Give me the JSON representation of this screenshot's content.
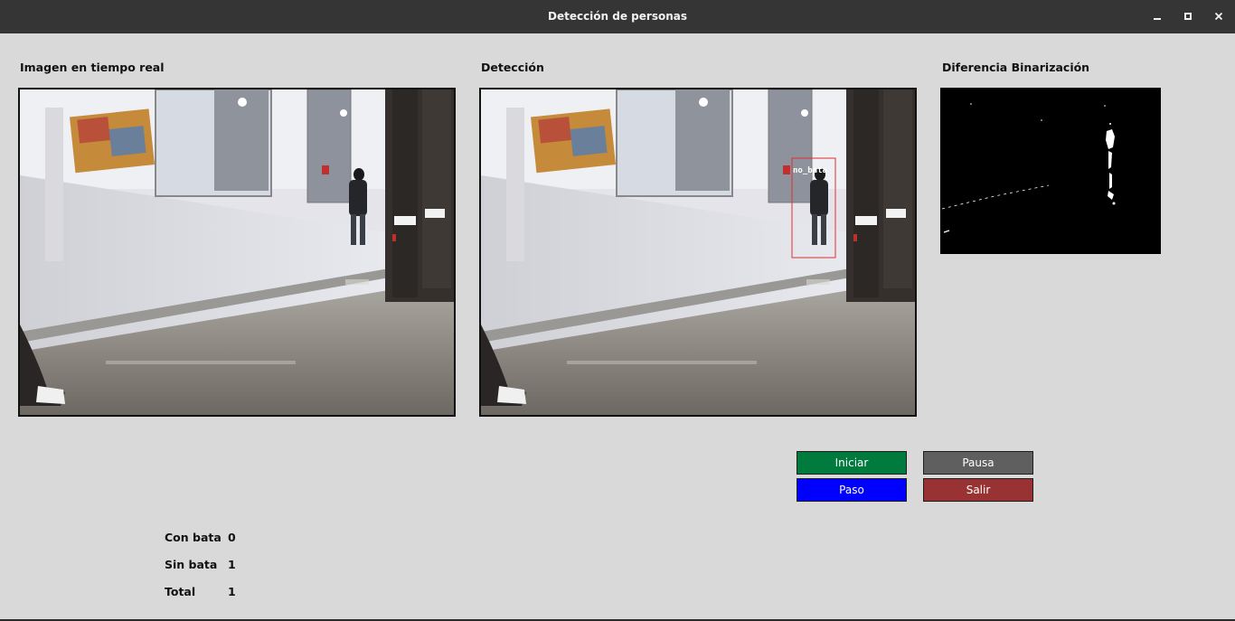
{
  "window": {
    "title": "Detección de personas"
  },
  "panels": {
    "live_label": "Imagen en tiempo real",
    "detection_label": "Detección",
    "binarization_label": "Diferencia Binarización"
  },
  "detection": {
    "box_label": "no_bata",
    "box_color": "#e03030"
  },
  "controls": {
    "start": "Iniciar",
    "pause": "Pausa",
    "step": "Paso",
    "exit": "Salir"
  },
  "stats": {
    "with_coat_label": "Con bata",
    "with_coat_value": "0",
    "without_coat_label": "Sin bata",
    "without_coat_value": "1",
    "total_label": "Total",
    "total_value": "1"
  },
  "colors": {
    "start": "#007a3d",
    "pause": "#5f5f5f",
    "step": "#0000ff",
    "exit": "#993333",
    "titlebar": "#353535",
    "background": "#d9d9d9"
  }
}
